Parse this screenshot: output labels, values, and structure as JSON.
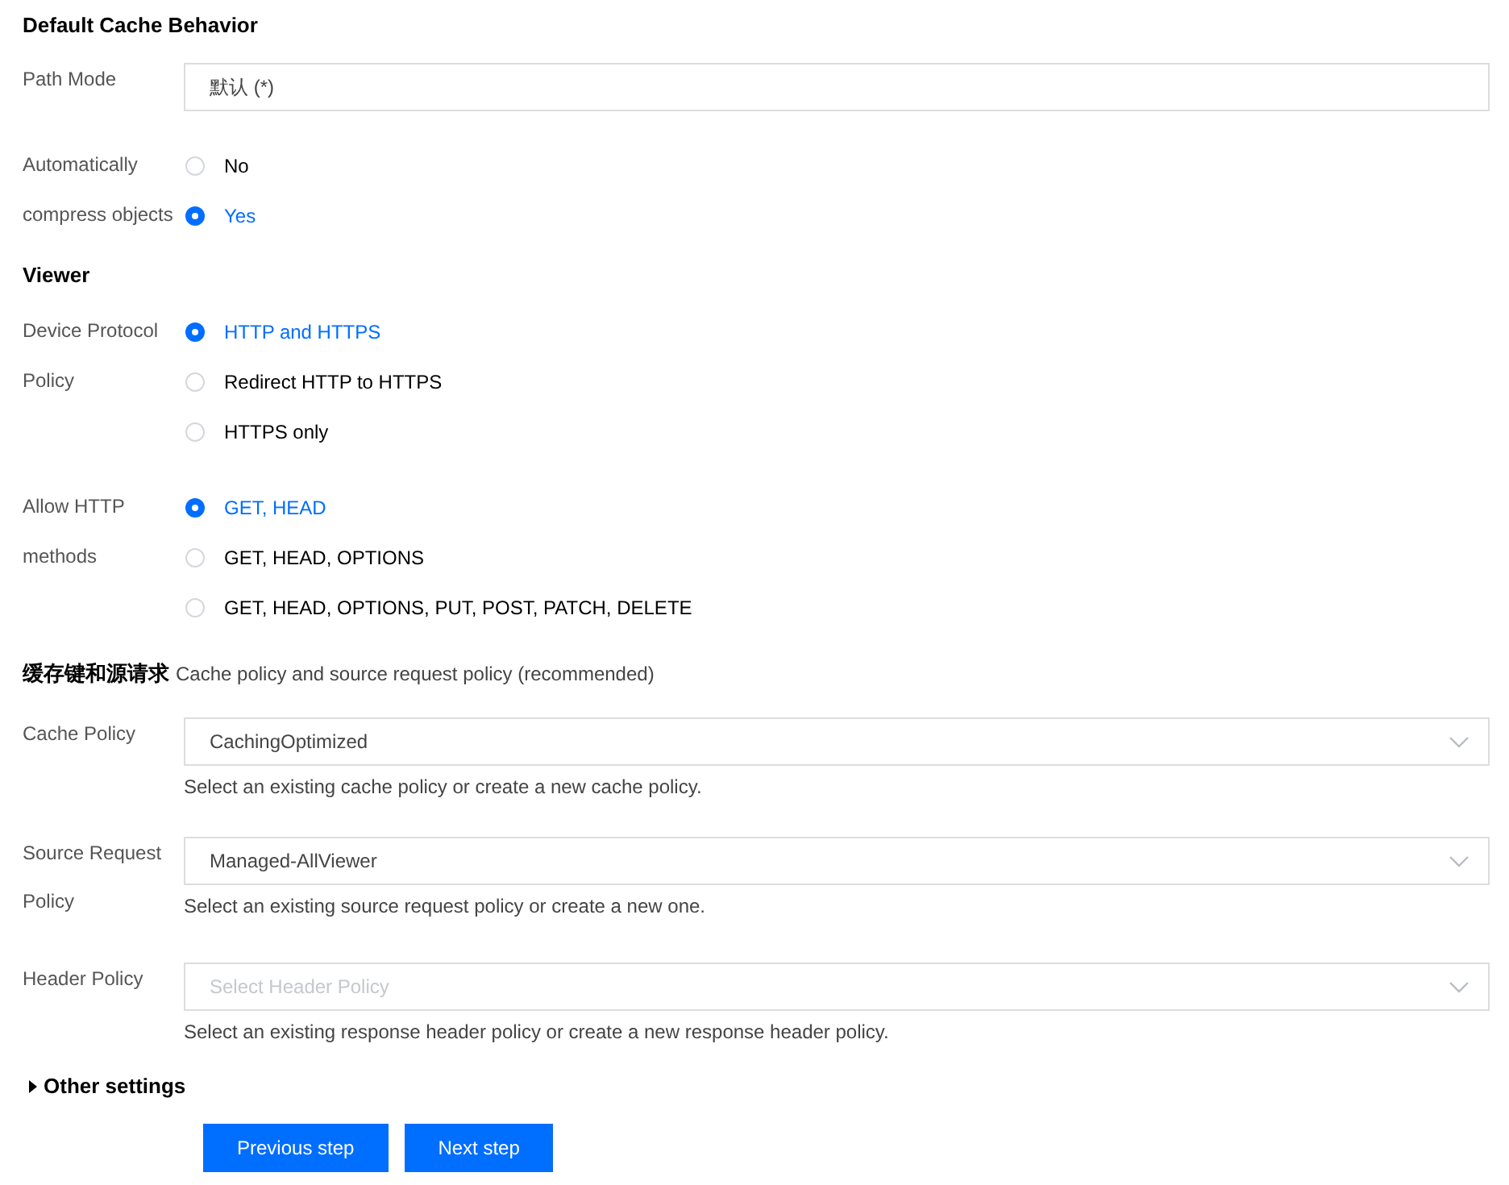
{
  "items": [
    {
      "kind": "title",
      "text": "Default Cache Behavior"
    },
    {
      "kind": "input",
      "label": "Path Mode",
      "value": "默认 (*)"
    },
    {
      "kind": "radio",
      "label": "Automatically compress objects",
      "options": [
        {
          "label": "No",
          "selected": false
        },
        {
          "label": "Yes",
          "selected": true
        }
      ]
    },
    {
      "kind": "title",
      "text": "Viewer"
    },
    {
      "kind": "radio",
      "label": "Device Protocol Policy",
      "options": [
        {
          "label": "HTTP and HTTPS",
          "selected": true
        },
        {
          "label": "Redirect HTTP to HTTPS",
          "selected": false
        },
        {
          "label": "HTTPS only",
          "selected": false
        }
      ]
    },
    {
      "kind": "radio",
      "label": "Allow HTTP methods",
      "options": [
        {
          "label": "GET, HEAD",
          "selected": true
        },
        {
          "label": "GET, HEAD, OPTIONS",
          "selected": false
        },
        {
          "label": "GET, HEAD, OPTIONS, PUT, POST, PATCH, DELETE",
          "selected": false
        }
      ]
    },
    {
      "kind": "title_note",
      "text": "缓存键和源请求",
      "note": "Cache policy and source request policy (recommended)"
    },
    {
      "kind": "select",
      "label": "Cache Policy",
      "value": "CachingOptimized",
      "help": "Select an existing cache policy or create a new cache policy."
    },
    {
      "kind": "select",
      "label": "Source Request Policy",
      "value": "Managed-AllViewer",
      "help": "Select an existing source request policy or create a new one."
    },
    {
      "kind": "select",
      "label": "Header Policy",
      "placeholder": "Select Header Policy",
      "help": "Select an existing response header policy or create a new response header policy."
    },
    {
      "kind": "expander",
      "label": "Other settings",
      "expanded": false
    },
    {
      "kind": "buttons",
      "buttons": [
        "Previous step",
        "Next step"
      ]
    }
  ]
}
